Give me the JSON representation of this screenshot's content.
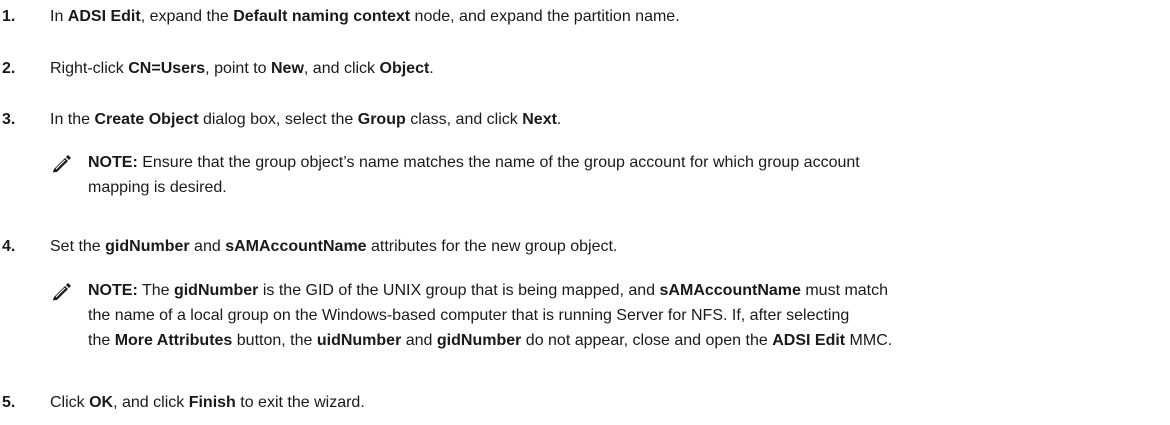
{
  "steps": [
    {
      "number": "1.",
      "parts": [
        {
          "t": "In "
        },
        {
          "t": "ADSI Edit",
          "b": true
        },
        {
          "t": ", expand the "
        },
        {
          "t": "Default naming context",
          "b": true
        },
        {
          "t": " node, and expand the partition name."
        }
      ]
    },
    {
      "number": "2.",
      "parts": [
        {
          "t": "Right-click "
        },
        {
          "t": "CN=Users",
          "b": true
        },
        {
          "t": ", point to "
        },
        {
          "t": "New",
          "b": true
        },
        {
          "t": ", and click "
        },
        {
          "t": "Object",
          "b": true
        },
        {
          "t": "."
        }
      ]
    },
    {
      "number": "3.",
      "parts": [
        {
          "t": "In the "
        },
        {
          "t": "Create Object",
          "b": true
        },
        {
          "t": " dialog box, select the "
        },
        {
          "t": "Group",
          "b": true
        },
        {
          "t": " class, and click "
        },
        {
          "t": "Next",
          "b": true
        },
        {
          "t": "."
        }
      ]
    },
    {
      "number": "4.",
      "parts": [
        {
          "t": "Set the "
        },
        {
          "t": "gidNumber",
          "b": true
        },
        {
          "t": " and "
        },
        {
          "t": "sAMAccountName",
          "b": true
        },
        {
          "t": " attributes for the new group object."
        }
      ]
    },
    {
      "number": "5.",
      "parts": [
        {
          "t": "Click "
        },
        {
          "t": "OK",
          "b": true
        },
        {
          "t": ", and click "
        },
        {
          "t": "Finish",
          "b": true
        },
        {
          "t": " to exit the wizard."
        }
      ]
    }
  ],
  "notes": [
    {
      "icon": "pencil-note-icon",
      "lines": [
        [
          {
            "t": "NOTE:",
            "b": true
          },
          {
            "t": " Ensure that the group object’s name matches the name of the group account for which group account"
          }
        ],
        [
          {
            "t": "mapping is desired."
          }
        ]
      ]
    },
    {
      "icon": "pencil-note-icon",
      "lines": [
        [
          {
            "t": "NOTE:",
            "b": true
          },
          {
            "t": " The "
          },
          {
            "t": "gidNumber",
            "b": true
          },
          {
            "t": " is the GID of the UNIX group that is being mapped, and "
          },
          {
            "t": "sAMAccountName",
            "b": true
          },
          {
            "t": " must match"
          }
        ],
        [
          {
            "t": "the name of a local group on the Windows-based computer that is running Server for NFS. If, after selecting"
          }
        ],
        [
          {
            "t": "the "
          },
          {
            "t": "More Attributes",
            "b": true
          },
          {
            "t": " button, the "
          },
          {
            "t": "uidNumber",
            "b": true
          },
          {
            "t": " and "
          },
          {
            "t": "gidNumber",
            "b": true
          },
          {
            "t": " do not appear, close and open the "
          },
          {
            "t": "ADSI Edit",
            "b": true
          },
          {
            "t": " MMC."
          }
        ]
      ]
    }
  ]
}
